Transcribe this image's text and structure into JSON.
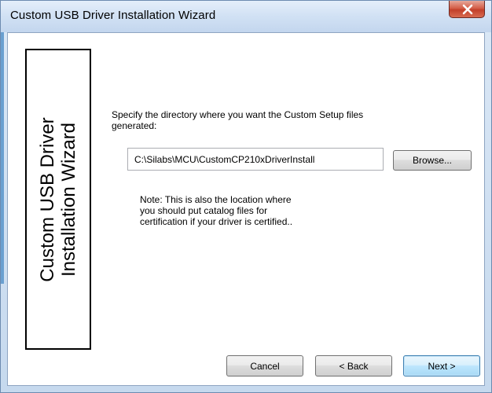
{
  "window": {
    "title": "Custom USB Driver Installation Wizard"
  },
  "side_panel": {
    "line1": "Custom USB Driver",
    "line2": "Installation Wizard"
  },
  "instruction": {
    "text": "Specify the directory where you want the Custom Setup files generated:"
  },
  "directory": {
    "value": "C:\\Silabs\\MCU\\CustomCP210xDriverInstall",
    "browse_label": "Browse..."
  },
  "note": {
    "line1": "Note: This is also the location where",
    "line2": "you should put catalog files for",
    "line3": "certification if your driver is certified.."
  },
  "buttons": {
    "cancel": "Cancel",
    "back": "< Back",
    "next": "Next >"
  },
  "icons": {
    "close": "close-icon"
  },
  "colors": {
    "title_bar": "#d1e1f4",
    "close_button": "#c2402a",
    "default_button_border": "#3c7fb1"
  }
}
